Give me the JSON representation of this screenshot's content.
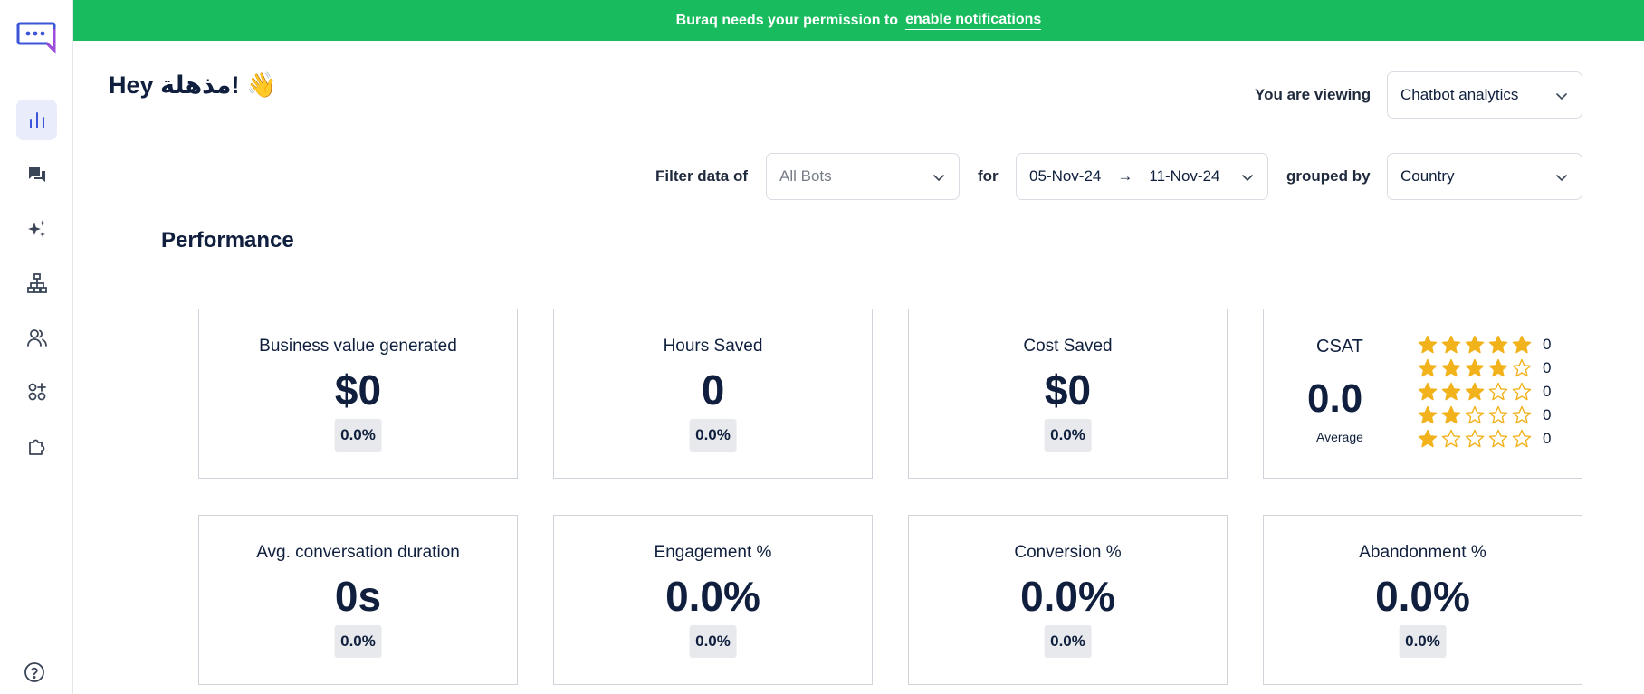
{
  "banner": {
    "text": "Buraq needs your permission to",
    "link": "enable notifications"
  },
  "greeting": "Hey مذهلة! 👋",
  "viewing": {
    "label": "You are viewing",
    "value": "Chatbot analytics"
  },
  "filters": {
    "filter_label": "Filter data of",
    "bots_placeholder": "All Bots",
    "for_label": "for",
    "date_from": "05-Nov-24",
    "date_arrow": "→",
    "date_to": "11-Nov-24",
    "grouped_label": "grouped by",
    "group_value": "Country"
  },
  "section": {
    "title": "Performance"
  },
  "cards": {
    "business_value": {
      "title": "Business value generated",
      "value": "$0",
      "change": "0.0%"
    },
    "hours_saved": {
      "title": "Hours Saved",
      "value": "0",
      "change": "0.0%"
    },
    "cost_saved": {
      "title": "Cost Saved",
      "value": "$0",
      "change": "0.0%"
    },
    "avg_duration": {
      "title": "Avg. conversation duration",
      "value": "0s",
      "change": "0.0%"
    },
    "engagement": {
      "title": "Engagement %",
      "value": "0.0%",
      "change": "0.0%"
    },
    "conversion": {
      "title": "Conversion %",
      "value": "0.0%",
      "change": "0.0%"
    },
    "abandonment": {
      "title": "Abandonment %",
      "value": "0.0%",
      "change": "0.0%"
    }
  },
  "csat": {
    "title": "CSAT",
    "value": "0.0",
    "avg_label": "Average",
    "ratings": [
      {
        "stars": 5,
        "count": "0"
      },
      {
        "stars": 4,
        "count": "0"
      },
      {
        "stars": 3,
        "count": "0"
      },
      {
        "stars": 2,
        "count": "0"
      },
      {
        "stars": 1,
        "count": "0"
      }
    ]
  },
  "icons": {
    "logo": "chat-bubble-logo-icon",
    "nav": [
      "analytics-icon",
      "conversations-icon",
      "ai-sparkle-icon",
      "flow-builder-icon",
      "users-icon",
      "apps-icon",
      "integrations-icon"
    ],
    "help": "help-icon"
  },
  "colors": {
    "banner": "#18bc5e",
    "accent": "#3b55d9",
    "star": "#f2b21b",
    "text": "#0f1f3d"
  }
}
